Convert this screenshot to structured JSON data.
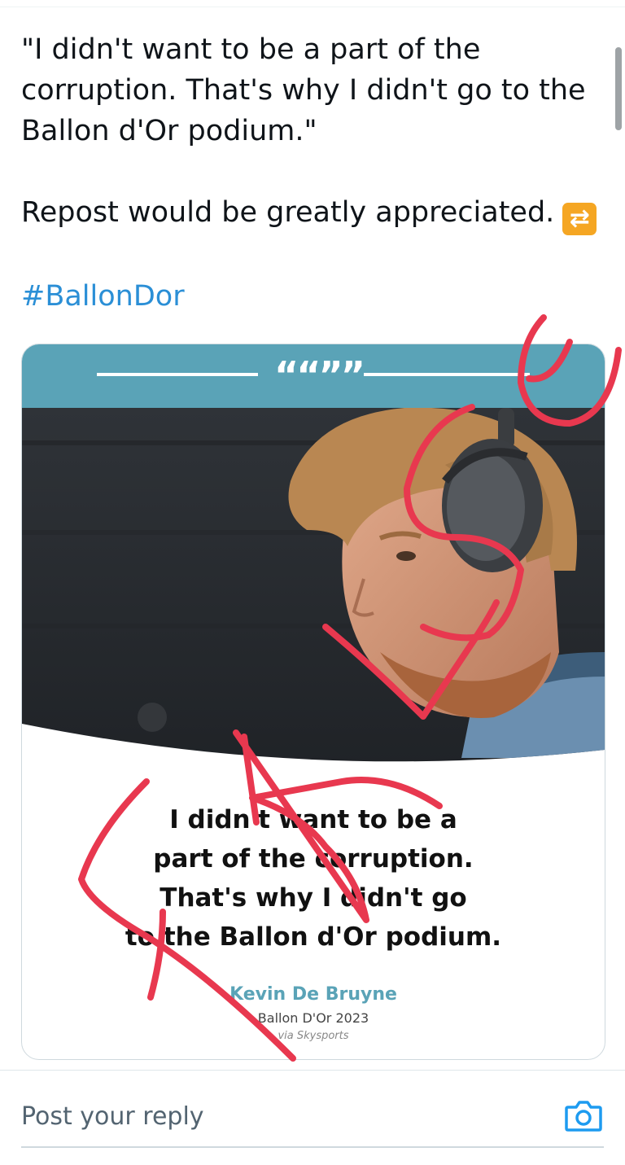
{
  "tweet": {
    "quote_line1": "\"I didn't want to be a part of the",
    "quote_line2": "corruption. That's why I didn't go to the",
    "quote_line3": "Ballon d'Or podium.\"",
    "repost_text": "Repost would be greatly appreciated.",
    "repost_emoji": "🔁",
    "hashtag": "#BallonDor"
  },
  "card": {
    "quote_mark": "““””",
    "quote_lines": [
      "I didn't want to be a",
      "part of the corruption.",
      "That's why I didn't go",
      "to the Ballon d'Or podium."
    ],
    "author": "Kevin De Bruyne",
    "subtitle": "Ballon D'Or 2023",
    "source": "via Skysports"
  },
  "reply": {
    "placeholder": "Post your reply"
  },
  "colors": {
    "hashtag": "#2b8fd6",
    "card_header": "#5aa3b7",
    "scribble": "#e8384f"
  },
  "icons": {
    "camera": "camera-icon",
    "repost_emoji": "repost-emoji-icon"
  }
}
